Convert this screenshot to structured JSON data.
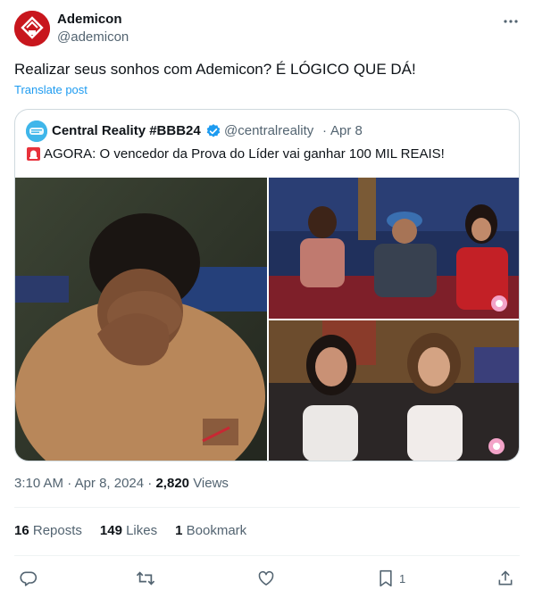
{
  "author": {
    "name": "Ademicon",
    "handle": "@ademicon"
  },
  "tweet": {
    "text": "Realizar seus sonhos com Ademicon? É LÓGICO QUE DÁ!",
    "translate_label": "Translate post"
  },
  "quoted": {
    "name": "Central Reality #BBB24",
    "handle": "@centralreality",
    "separator": "·",
    "date": "Apr 8",
    "siren_icon": "police-light-emoji",
    "text": "AGORA: O vencedor da Prova do Líder vai ganhar 100 MIL REAIS!",
    "avatar_label": "Central Reality"
  },
  "meta": {
    "time": "3:10 AM",
    "separator1": "·",
    "date": "Apr 8, 2024",
    "separator2": "·",
    "views_count": "2,820",
    "views_label": "Views"
  },
  "stats": {
    "reposts_count": "16",
    "reposts_label": "Reposts",
    "likes_count": "149",
    "likes_label": "Likes",
    "bookmarks_count": "1",
    "bookmarks_label": "Bookmark"
  },
  "actions": {
    "bookmark_count": "1"
  },
  "colors": {
    "accent": "#1d9bf0",
    "text": "#0f1419",
    "secondary": "#536471",
    "brand_red": "#c8161d"
  }
}
